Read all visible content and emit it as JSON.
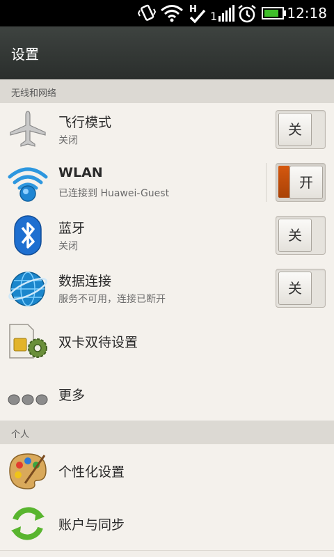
{
  "status_bar": {
    "time": "12:18",
    "icons": [
      "vibrate-icon",
      "wifi-icon",
      "hsdpa-icon",
      "signal-icon",
      "alarm-icon",
      "battery-icon"
    ],
    "network_type": "H"
  },
  "title_bar": {
    "title": "设置"
  },
  "sections": {
    "wireless": "无线和网络",
    "personal": "个人"
  },
  "rows": {
    "airplane": {
      "label": "飞行模式",
      "status": "关闭",
      "toggle": "关",
      "on": false
    },
    "wlan": {
      "label": "WLAN",
      "status": "已连接到 Huawei-Guest",
      "toggle": "开",
      "on": true
    },
    "bluetooth": {
      "label": "蓝牙",
      "status": "关闭",
      "toggle": "关",
      "on": false
    },
    "data": {
      "label": "数据连接",
      "status": "服务不可用，连接已断开",
      "toggle": "关",
      "on": false
    },
    "dual_sim": {
      "label": "双卡双待设置"
    },
    "more": {
      "label": "更多"
    },
    "personalize": {
      "label": "个性化设置"
    },
    "accounts": {
      "label": "账户与同步"
    }
  },
  "colors": {
    "toggle_on": "#c8500c",
    "title_bg": "#353937",
    "section_bg": "#dcd9d3"
  }
}
